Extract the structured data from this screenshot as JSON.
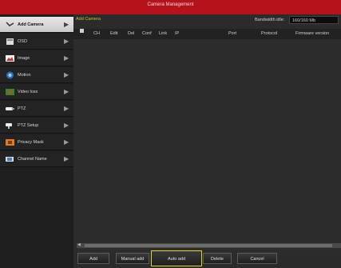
{
  "window": {
    "title": "Camera Management"
  },
  "sidebar": {
    "items": [
      {
        "label": "Add Camera",
        "icon": "add-camera-icon",
        "active": true
      },
      {
        "label": "OSD",
        "icon": "osd-icon",
        "active": false
      },
      {
        "label": "Image",
        "icon": "image-icon",
        "active": false
      },
      {
        "label": "Motion",
        "icon": "motion-icon",
        "active": false
      },
      {
        "label": "Video loss",
        "icon": "video-loss-icon",
        "active": false
      },
      {
        "label": "PTZ",
        "icon": "ptz-icon",
        "active": false
      },
      {
        "label": "PTZ Setup",
        "icon": "ptz-setup-icon",
        "active": false
      },
      {
        "label": "Privacy Mask",
        "icon": "privacy-mask-icon",
        "active": false
      },
      {
        "label": "Channel Name",
        "icon": "channel-name-icon",
        "active": false
      }
    ]
  },
  "main": {
    "section_title": "Add Camera",
    "bandwidth_label": "Bandwidth idle:",
    "bandwidth_value": "160/160 Mb",
    "columns": [
      "CH",
      "Edit",
      "Del",
      "Conf",
      "Link",
      "IP",
      "Port",
      "Protocol",
      "Firmware version"
    ]
  },
  "buttons": {
    "add": "Add",
    "manual_add": "Manual add",
    "auto_add": "Auto add",
    "delete": "Delete",
    "cancel": "Cancel"
  },
  "colors": {
    "title_bar": "#b5121b",
    "section_title": "#c7c324",
    "focus_border": "#e5d900"
  }
}
